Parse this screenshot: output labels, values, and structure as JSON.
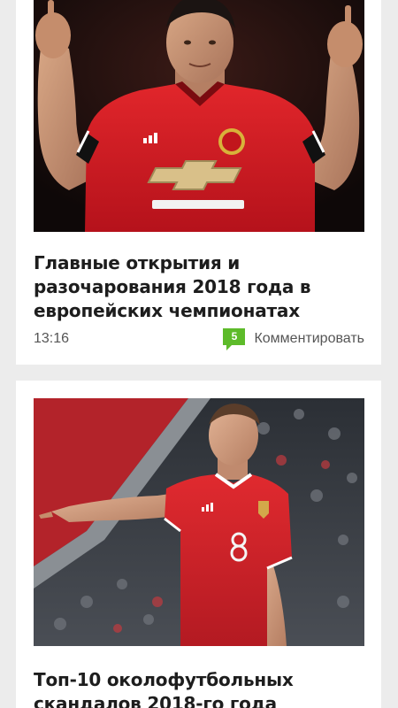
{
  "feed": {
    "articles": [
      {
        "title": "Главные открытия и разочарования 2018 года в европейских чемпионатах",
        "time": "13:16",
        "comment_count": "5",
        "comment_label": "Комментировать",
        "image_icon": "photo-player-celebrating"
      },
      {
        "title": "Топ-10 околофутбольных скандалов 2018-го года",
        "image_icon": "photo-player-pointing"
      }
    ],
    "colors": {
      "background": "#ececec",
      "card": "#ffffff",
      "comment_badge": "#5dbb2a",
      "title_text": "#1d1d1d",
      "meta_text": "#555555"
    }
  }
}
